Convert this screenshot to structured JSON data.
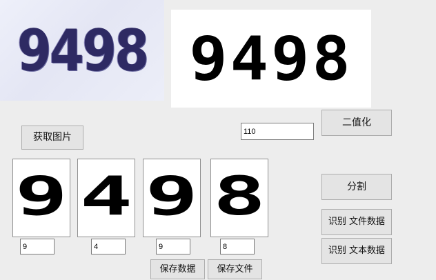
{
  "captcha": {
    "text": "9498"
  },
  "binary": {
    "text": "9498"
  },
  "threshold": {
    "value": "110"
  },
  "buttons": {
    "get_image": "获取图片",
    "binarize": "二值化",
    "split": "分割",
    "recognize_file": "识别 文件数据",
    "recognize_text": "识别 文本数据",
    "save_data": "保存数据",
    "save_file": "保存文件"
  },
  "segments": [
    {
      "glyph": "9",
      "value": "9"
    },
    {
      "glyph": "4",
      "value": "4"
    },
    {
      "glyph": "9",
      "value": "9"
    },
    {
      "glyph": "8",
      "value": "8"
    }
  ]
}
